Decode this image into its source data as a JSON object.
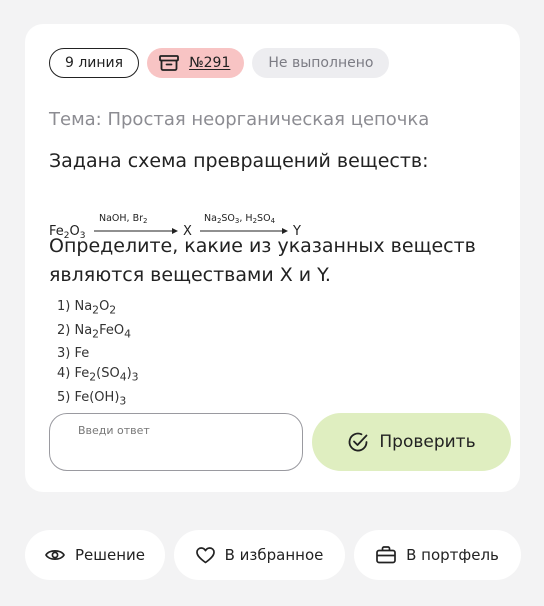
{
  "tags": {
    "line": "9 линия",
    "number": "№291",
    "status": "Не выполнено"
  },
  "topic": "Тема: Простая неорганическая цепочка",
  "lead": "Задана схема превращений веществ:",
  "scheme": {
    "start": "Fe2O3",
    "arrow1_reagents": "NaOH, Br2",
    "intermediate": "X",
    "arrow2_reagents": "Na2SO3, H2SO4",
    "end": "Y"
  },
  "question": "Определите, какие из указанных веществ являются веществами X и Y.",
  "options": [
    "1) Na2O2",
    "2) Na2FeO4",
    "3) Fe",
    "4) Fe2(SO4)3",
    "5) Fe(OH)3"
  ],
  "answer": {
    "placeholder": "Введи ответ",
    "value": ""
  },
  "check_label": "Проверить",
  "actions": {
    "solution": "Решение",
    "favorite": "В избранное",
    "portfolio": "В портфель"
  },
  "colors": {
    "page_bg": "#f3f3f4",
    "card_bg": "#ffffff",
    "number_tag_bg": "#f8c4c4",
    "status_tag_bg": "#ededf0",
    "check_button_bg": "#dfeec0"
  },
  "icons": {
    "number_tag": "archive-box-icon",
    "check": "check-circle-icon",
    "solution": "eye-icon",
    "favorite": "heart-icon",
    "portfolio": "briefcase-icon"
  }
}
